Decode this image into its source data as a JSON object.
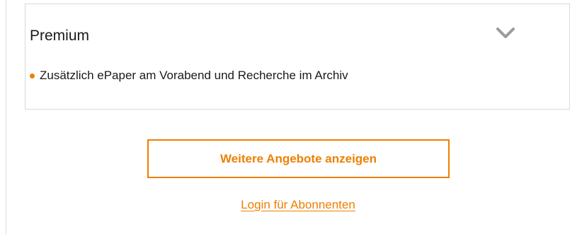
{
  "premium": {
    "title": "Premium",
    "features": [
      "Zusätzlich ePaper am Vorabend und Recherche im Archiv"
    ],
    "toggle_icon": "chevron-down-icon"
  },
  "actions": {
    "more_offers_label": "Weitere Angebote anzeigen",
    "login_label": "Login für Abonnenten"
  },
  "colors": {
    "accent": "#ee7f00",
    "text": "#1a1a1a",
    "border": "#d9d9d9",
    "chevron": "#9b9b9b"
  }
}
